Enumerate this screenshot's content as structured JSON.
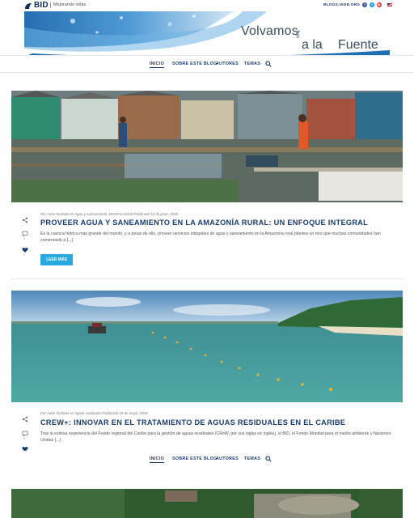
{
  "header": {
    "logo_text": "BID",
    "tagline": "Mejorando vidas",
    "blogs_link": "BLOGS.IADB.ORG",
    "social_icons": [
      "facebook-icon",
      "twitter-icon",
      "youtube-icon",
      "rss-icon"
    ],
    "flag_icon": "language-flag-icon"
  },
  "banner": {
    "line1": "Volvamos",
    "by_word": "blog",
    "line2_a": "a la",
    "line2_b": "Fuente"
  },
  "nav": {
    "items": [
      {
        "label": "INICIO",
        "active": true
      },
      {
        "label": "SOBRE ESTE BLOG",
        "active": false
      },
      {
        "label": "AUTORES",
        "active": false
      },
      {
        "label": "TEMAS",
        "active": false
      }
    ],
    "search_icon": "search-icon"
  },
  "posts": [
    {
      "meta": "Por Autor Invitado en Agua y saneamiento, DESTACADOS Publicado 12 de junio, 2018",
      "title": "PROVEER AGUA Y SANEAMIENTO EN LA AMAZONÍA RURAL: UN ENFOQUE INTEGRAL",
      "excerpt": "Es la cuenca hídrica más grande del mundo, y a pesar de ello, proveer servicios integrales de agua y saneamiento en la Amazonía rural plantea un reto que muchas comunidades han comenzado a [...]",
      "read_more": "LEER MÁS",
      "comments": "0",
      "likes": "0"
    },
    {
      "meta": "Por Autor Invitado en Aguas residuales Publicado 24 de mayo, 2018",
      "title": "CREW+: INNOVAR EN EL TRATAMIENTO DE AGUAS RESIDUALES EN EL CARIBE",
      "excerpt": "Tras la exitosa experiencia del Fondo regional del Caribe para la gestión de aguas residuales (CReW, por sus siglas en inglés), el BID, el Fondo Mundial para el medio ambiente y Naciones Unidas [...]",
      "comments": "0"
    }
  ],
  "colors": {
    "brand_navy": "#1a3d6e",
    "button_blue": "#2aa8e0"
  }
}
